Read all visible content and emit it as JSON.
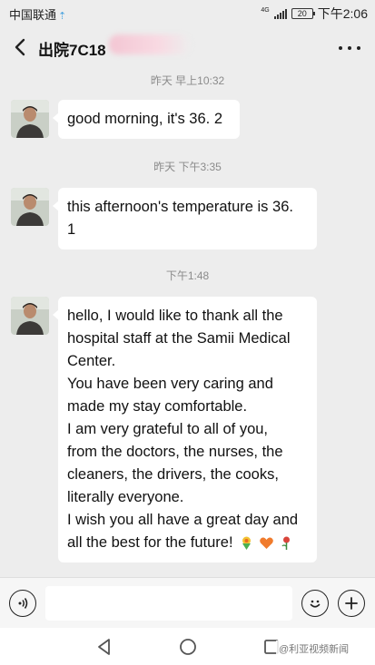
{
  "status_bar": {
    "carrier": "中国联通",
    "network": "4G",
    "battery": "20",
    "time": "下午2:06"
  },
  "header": {
    "title": "出院7C18",
    "back_icon": "chevron-left-icon",
    "more_icon": "more-dots-icon"
  },
  "messages": [
    {
      "timestamp": "昨天 早上10:32",
      "text": "good morning, it's 36. 2"
    },
    {
      "timestamp": "昨天 下午3:35",
      "lines": [
        "this afternoon's temperature is 36.",
        "1"
      ]
    },
    {
      "timestamp": "下午1:48",
      "lines": [
        "hello, I would like to thank all the",
        "hospital staff at the Samii Medical",
        "Center.",
        "You have been very caring and",
        "made my stay comfortable.",
        "I am very grateful to all of you,",
        "from the doctors, the nurses, the",
        "cleaners, the drivers, the cooks,",
        "literally everyone.",
        "I wish you all have a great day and",
        "all the best for the future!"
      ],
      "emojis": [
        "bouquet-icon",
        "heart-icon",
        "rose-icon"
      ]
    }
  ],
  "input_bar": {
    "voice_icon": "voice-icon",
    "emoji_icon": "smiley-icon",
    "plus_icon": "plus-icon",
    "message_value": ""
  },
  "nav_bar": {
    "back_icon": "triangle-back-icon",
    "home_icon": "circle-home-icon",
    "recent_icon": "square-recent-icon"
  },
  "watermark": "@利亚视频新闻"
}
